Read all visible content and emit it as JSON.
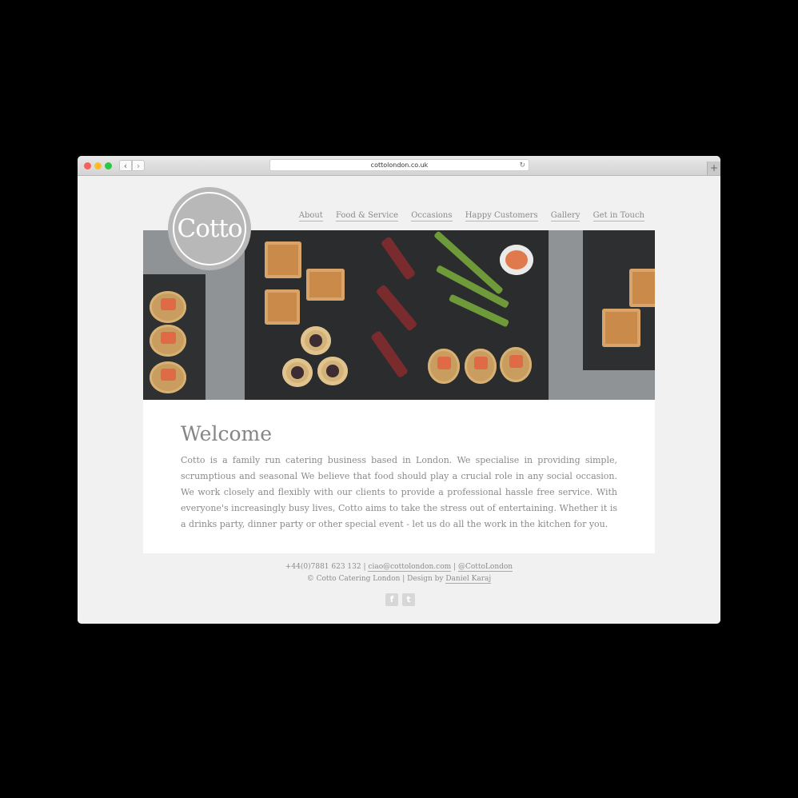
{
  "browser": {
    "url": "cottolondon.co.uk",
    "back_glyph": "‹",
    "forward_glyph": "›",
    "reload_glyph": "↻",
    "new_tab_glyph": "+"
  },
  "logo": {
    "text": "Cotto"
  },
  "nav": {
    "items": [
      {
        "label": "About"
      },
      {
        "label": "Food & Service"
      },
      {
        "label": "Occasions"
      },
      {
        "label": "Happy Customers"
      },
      {
        "label": "Gallery"
      },
      {
        "label": "Get in Touch"
      }
    ]
  },
  "welcome": {
    "title": "Welcome",
    "body": "Cotto is a family run catering business based in London. We specialise in providing simple, scrumptious and seasonal We believe that food should play a crucial role in any social occasion. We work closely and flexibly with our clients to provide a professional hassle free service. With everyone's increasingly busy lives, Cotto aims to take the stress out of entertaining. Whether it is a drinks party, dinner party or other special event - let us do all the work in the kitchen for you."
  },
  "footer": {
    "phone": "+44(0)7881 623 132",
    "separator": "|",
    "email": "ciao@cottolondon.com",
    "twitter_handle": "@CottoLondon",
    "copyright": "© Cotto Catering London | Design by",
    "designer": "Daniel Karaj",
    "facebook_icon": "f",
    "twitter_icon": "t"
  },
  "colors": {
    "background": "#000000",
    "page": "#f1f1f1",
    "logo": "#b8b8b9",
    "text": "#8a8a8a"
  }
}
